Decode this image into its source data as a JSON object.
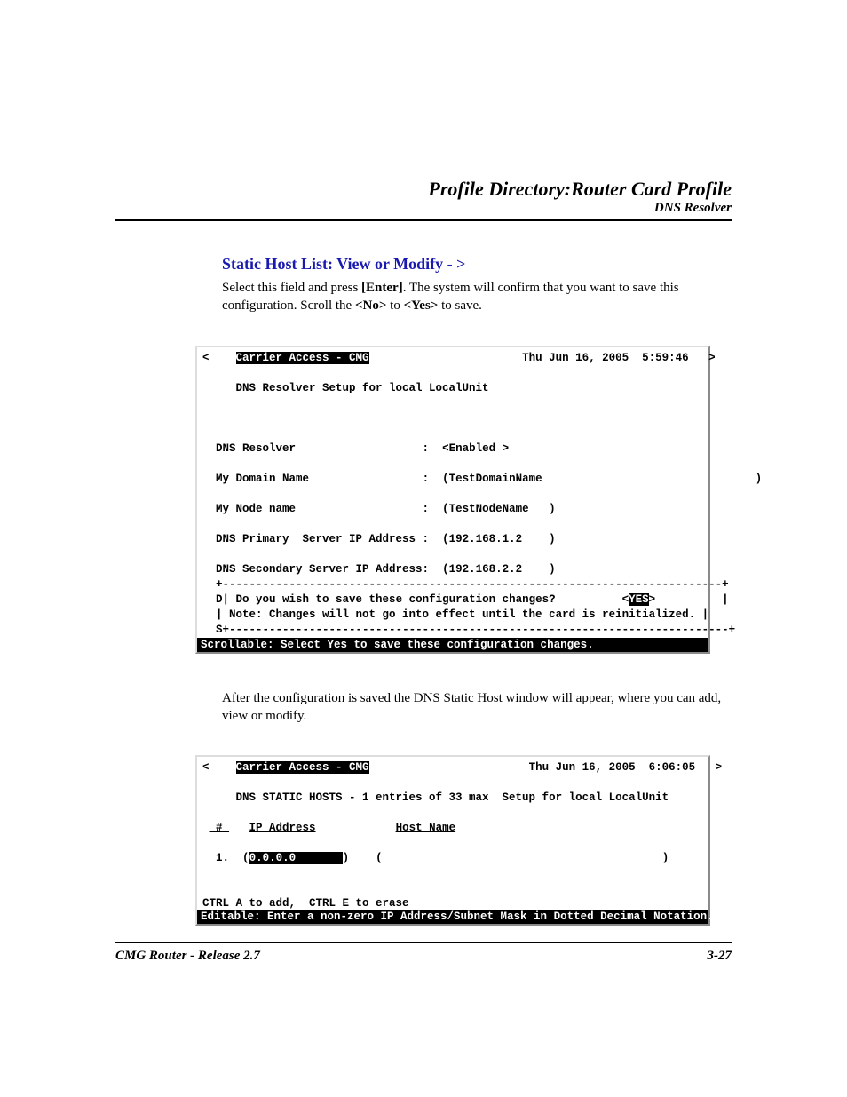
{
  "header": {
    "title": "Profile Directory:Router Card Profile",
    "subtitle": "DNS Resolver"
  },
  "section": {
    "heading": "Static Host List: View or Modify - >",
    "body_before": "Select this field and press ",
    "body_enter": "[Enter]",
    "body_after": ". The system will confirm that you want to save this configuration. Scroll the ",
    "body_no": "<No>",
    "body_to": " to ",
    "body_yes": "<Yes>",
    "body_end": " to save."
  },
  "terminal1": {
    "arrow_l": "<",
    "brand": "Carrier Access - CMG",
    "timestamp": "Thu Jun 16, 2005  5:59:46_",
    "arrow_r": ">",
    "title_line": "     DNS Resolver Setup for local LocalUnit",
    "f1_label": "DNS Resolver",
    "f1_value": "<Enabled >",
    "f2_label": "My Domain Name",
    "f2_value": "(TestDomainName",
    "f2_trail": ")",
    "f3_label": "My Node name",
    "f3_value": "(TestNodeName   )",
    "f4_label": "DNS Primary  Server IP Address :",
    "f4_value": "(192.168.1.2    )",
    "f5_label": "DNS Secondary Server IP Address:",
    "f5_value": "(192.168.2.2    )",
    "box_top": "  +---------------------------------------------------------------------------+",
    "box_d": "D",
    "box_q": "| Do you wish to save these configuration changes?          <",
    "box_yes": "YES",
    "box_qend": ">          |",
    "box_note": "  | Note: Changes will not go into effect until the card is reinitialized. |",
    "box_s": "S",
    "box_bot": "+---------------------------------------------------------------------------+",
    "status": "Scrollable: Select Yes to save these configuration changes.                 "
  },
  "after": "After the configuration is saved the DNS Static Host window will appear, where you can add, view or modify.",
  "terminal2": {
    "arrow_l": "<",
    "brand": "Carrier Access - CMG",
    "timestamp": "Thu Jun 16, 2005  6:06:05",
    "arrow_r": ">",
    "title_line": "     DNS STATIC HOSTS - 1 entries of 33 max  Setup for local LocalUnit",
    "col_num": " # ",
    "col_ip": "IP Address",
    "col_host": "Host Name",
    "row_num": " 1.",
    "row_ip_open": "(",
    "row_ip_0": "0",
    "row_ip_mid": ".0.0.0       ",
    "row_ip_close": ")",
    "row_host_open": "(",
    "row_host_close": ")",
    "help": "CTRL A to add,  CTRL E to erase",
    "status": "Editable: Enter a non-zero IP Address/Subnet Mask in Dotted Decimal Notation."
  },
  "footer": {
    "left": "CMG Router - Release 2.7",
    "right": "3-27"
  }
}
